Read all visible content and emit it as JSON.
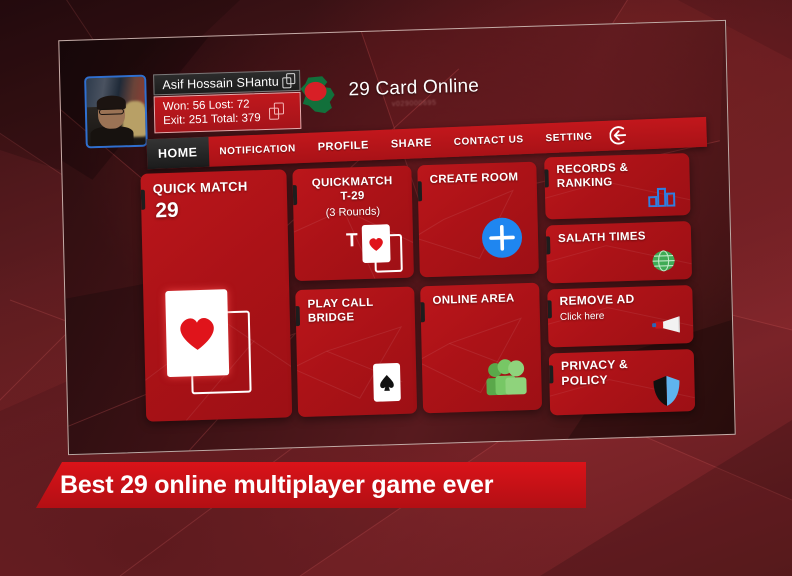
{
  "app": {
    "brand_title": "29 Card Online",
    "brand_subtext": "v029000695",
    "flag_icon": "bangladesh-flag-map-icon"
  },
  "profile": {
    "avatar_icon": "user-avatar-photo",
    "name": "Asif Hossain SHantu",
    "name_copy_icon": "copy-icon",
    "stats_copy_icon": "copy-icon",
    "stats_line1": "Won: 56 Lost: 72",
    "stats_line2": "Exit: 251 Total: 379",
    "stats": {
      "won": 56,
      "lost": 72,
      "exit": 251,
      "total": 379
    }
  },
  "nav": {
    "items": [
      {
        "label": "HOME",
        "active": true
      },
      {
        "label": "NOTIFICATION",
        "active": false
      },
      {
        "label": "PROFILE",
        "active": false
      },
      {
        "label": "SHARE",
        "active": false
      },
      {
        "label": "CONTACT US",
        "active": false
      },
      {
        "label": "SETTING",
        "active": false
      }
    ],
    "exit_icon": "logout-icon"
  },
  "menu": {
    "quick_match": {
      "title": "QUICK MATCH",
      "number": "29",
      "icon": "heart-card-icon"
    },
    "quickmatch_t29": {
      "title": "QUICKMATCH",
      "subtitle_line": "T-29",
      "rounds": "(3 Rounds)",
      "icon": "t-heart-card-icon",
      "badge": "T"
    },
    "create_room": {
      "title": "CREATE ROOM",
      "icon": "plus-circle-icon"
    },
    "play_call_bridge": {
      "title_line1": "PLAY CALL",
      "title_line2": "BRIDGE",
      "icon": "spade-card-icon"
    },
    "online_area": {
      "title": "ONLINE AREA",
      "icon": "people-group-icon"
    },
    "records_ranking": {
      "title_line1": "RECORDS &",
      "title_line2": "RANKING",
      "icon": "bar-chart-icon"
    },
    "salath_times": {
      "title": "SALATH TIMES",
      "icon": "globe-compass-icon"
    },
    "remove_ad": {
      "title": "REMOVE AD",
      "subtitle": "Click here",
      "icon": "megaphone-icon"
    },
    "privacy_policy": {
      "title_line1": "PRIVACY  &",
      "title_line2": "POLICY",
      "icon": "shield-icon"
    }
  },
  "banner": {
    "text": "Best 29 online multiplayer game ever"
  },
  "colors": {
    "tile_red": "#b01419",
    "nav_red": "#b8151a",
    "banner_red": "#cf1217",
    "accent_blue": "#1f86f0",
    "avatar_border_blue": "#2f6fd0",
    "people_green": "#7bc062",
    "flag_green": "#12703b",
    "page_bg": "#5b1a1e"
  }
}
